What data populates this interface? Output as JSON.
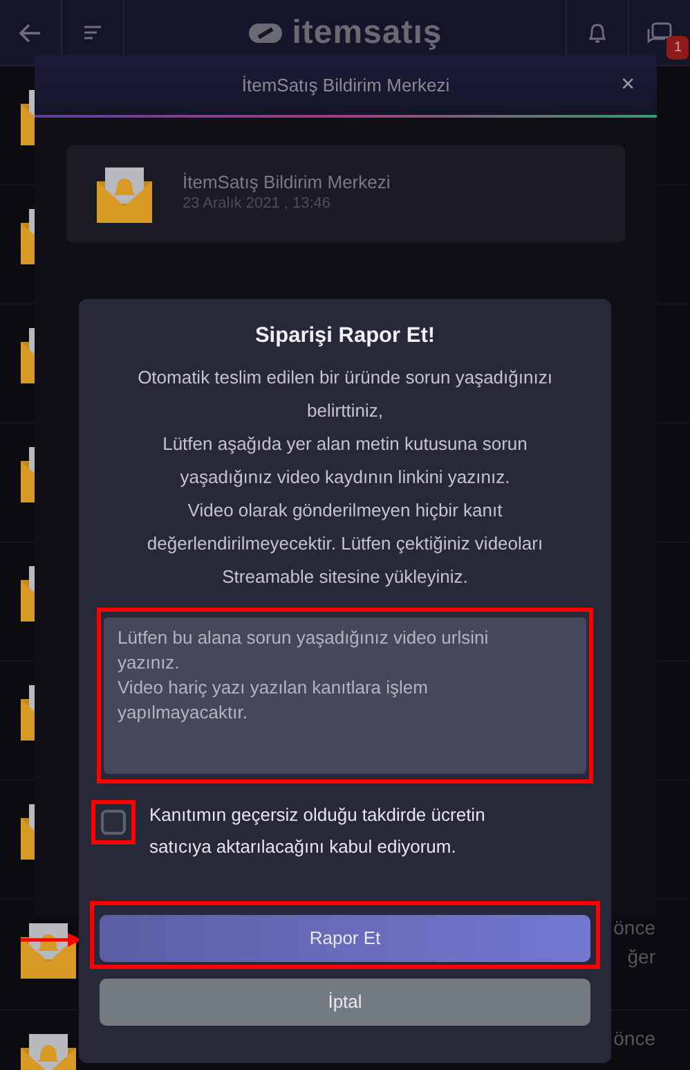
{
  "navbar": {
    "logo": "itemsatış",
    "message_badge": "1"
  },
  "background_list": {
    "rows": [
      {
        "texts": [
          "önce",
          "ğer"
        ]
      },
      {
        "texts": [
          "önce"
        ]
      }
    ]
  },
  "notification_center": {
    "title": "İtemSatış Bildirim Merkezi",
    "close": "×",
    "card": {
      "title": "İtemSatış Bildirim Merkezi",
      "date": "23 Aralık 2021 , 13:46"
    }
  },
  "report_dialog": {
    "title": "Siparişi Rapor Et!",
    "message": [
      "Otomatik teslim edilen bir üründe sorun yaşadığınızı belirttiniz,",
      "Lütfen aşağıda yer alan metin kutusuna sorun yaşadığınız video kaydının linkini yazınız.",
      "Video olarak gönderilmeyen hiçbir kanıt değerlendirilmeyecektir. Lütfen çektiğiniz videoları Streamable sitesine yükleyiniz."
    ],
    "textarea": {
      "placeholder": "Lütfen bu alana sorun yaşadığınız video urlsini yazınız.\nVideo hariç yazı yazılan kanıtlara işlem yapılmayacaktır.",
      "highlighted": true
    },
    "consent": {
      "label": "Kanıtımın geçersiz olduğu takdirde ücretin satıcıya aktarılacağını kabul ediyorum.",
      "checked": false,
      "highlighted": true
    },
    "buttons": [
      {
        "label": "Rapor Et",
        "kind": "primary",
        "highlighted": true,
        "pointer": true
      },
      {
        "label": "İptal",
        "kind": "secondary"
      }
    ]
  }
}
